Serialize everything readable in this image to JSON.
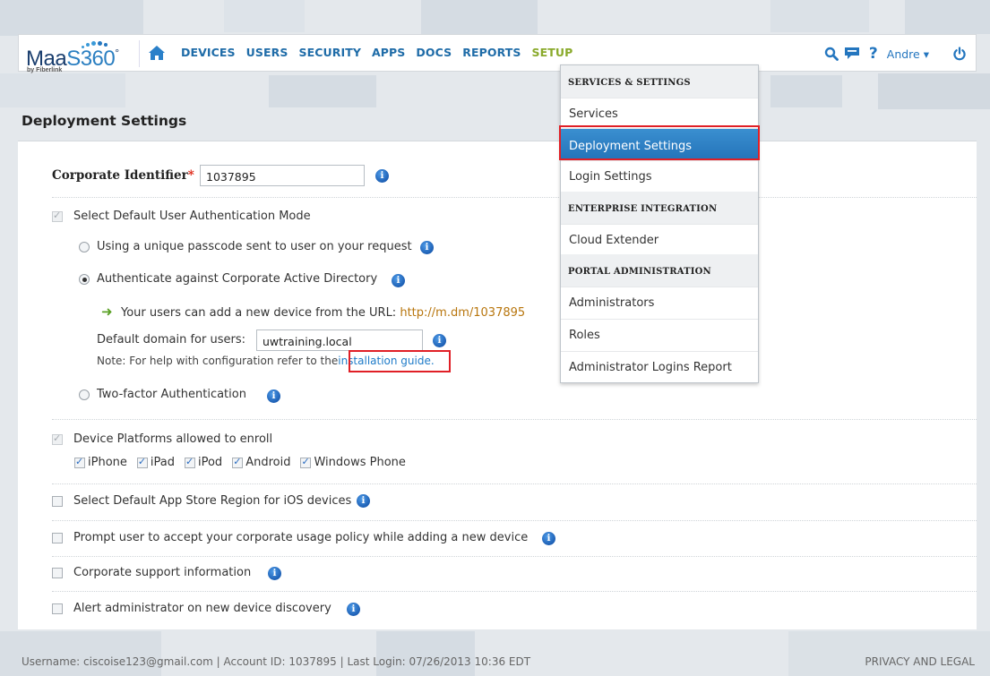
{
  "logo": {
    "main_prefix": "Maa",
    "main_s": "S",
    "main_suffix": "360",
    "trademark": "°",
    "sub": "by Fiberlink"
  },
  "nav": [
    "DEVICES",
    "USERS",
    "SECURITY",
    "APPS",
    "DOCS",
    "REPORTS",
    "SETUP"
  ],
  "active_nav": "SETUP",
  "header_icons": [
    "search-icon",
    "chat-icon",
    "help-icon",
    "power-icon"
  ],
  "user": {
    "name": "Andre",
    "caret": "▾"
  },
  "help_symbol": "?",
  "page_title": "Deployment Settings",
  "corporate": {
    "label": "Corporate Identifier",
    "required_mark": "*",
    "value": "1037895"
  },
  "auth": {
    "label": "Select Default User Authentication Mode",
    "options": {
      "passcode": "Using a unique passcode sent to user on your request",
      "ad": "Authenticate against Corporate Active Directory",
      "twofactor": "Two-factor Authentication"
    },
    "selected": "ad",
    "url_text": "Your users can add a new device from the URL:",
    "url": "http://m.dm/1037895",
    "domain_label": "Default domain for users:",
    "domain_value": "uwtraining.local",
    "note_prefix": "Note:  For help with configuration refer to the",
    "note_link": "installation guide."
  },
  "platforms": {
    "label": "Device Platforms allowed to enroll",
    "items": [
      "iPhone",
      "iPad",
      "iPod",
      "Android",
      "Windows Phone"
    ]
  },
  "settings": [
    {
      "label": "Select Default App Store Region for iOS devices",
      "checked": false
    },
    {
      "label": "Prompt user to accept your corporate usage policy while adding a new device",
      "checked": false
    },
    {
      "label": "Corporate support information",
      "checked": false
    },
    {
      "label": "Alert administrator on new device discovery",
      "checked": false
    }
  ],
  "dropdown": {
    "sections": [
      {
        "header": "SERVICES & SETTINGS",
        "items": [
          "Services",
          "Deployment Settings",
          "Login Settings"
        ]
      },
      {
        "header": "ENTERPRISE INTEGRATION",
        "items": [
          "Cloud Extender"
        ]
      },
      {
        "header": "PORTAL ADMINISTRATION",
        "items": [
          "Administrators",
          "Roles",
          "Administrator Logins Report"
        ]
      }
    ],
    "active_item": "Deployment Settings"
  },
  "footer": {
    "status": "Username: ciscoise123@gmail.com  | Account ID:  1037895  | Last Login: 07/26/2013 10:36 EDT",
    "right_link": "PRIVACY AND LEGAL"
  },
  "colors": {
    "nav": "#1f6ca8",
    "active_nav": "#8aaa2c",
    "accent": "#2a80c9",
    "highlight": "#e01f26"
  }
}
